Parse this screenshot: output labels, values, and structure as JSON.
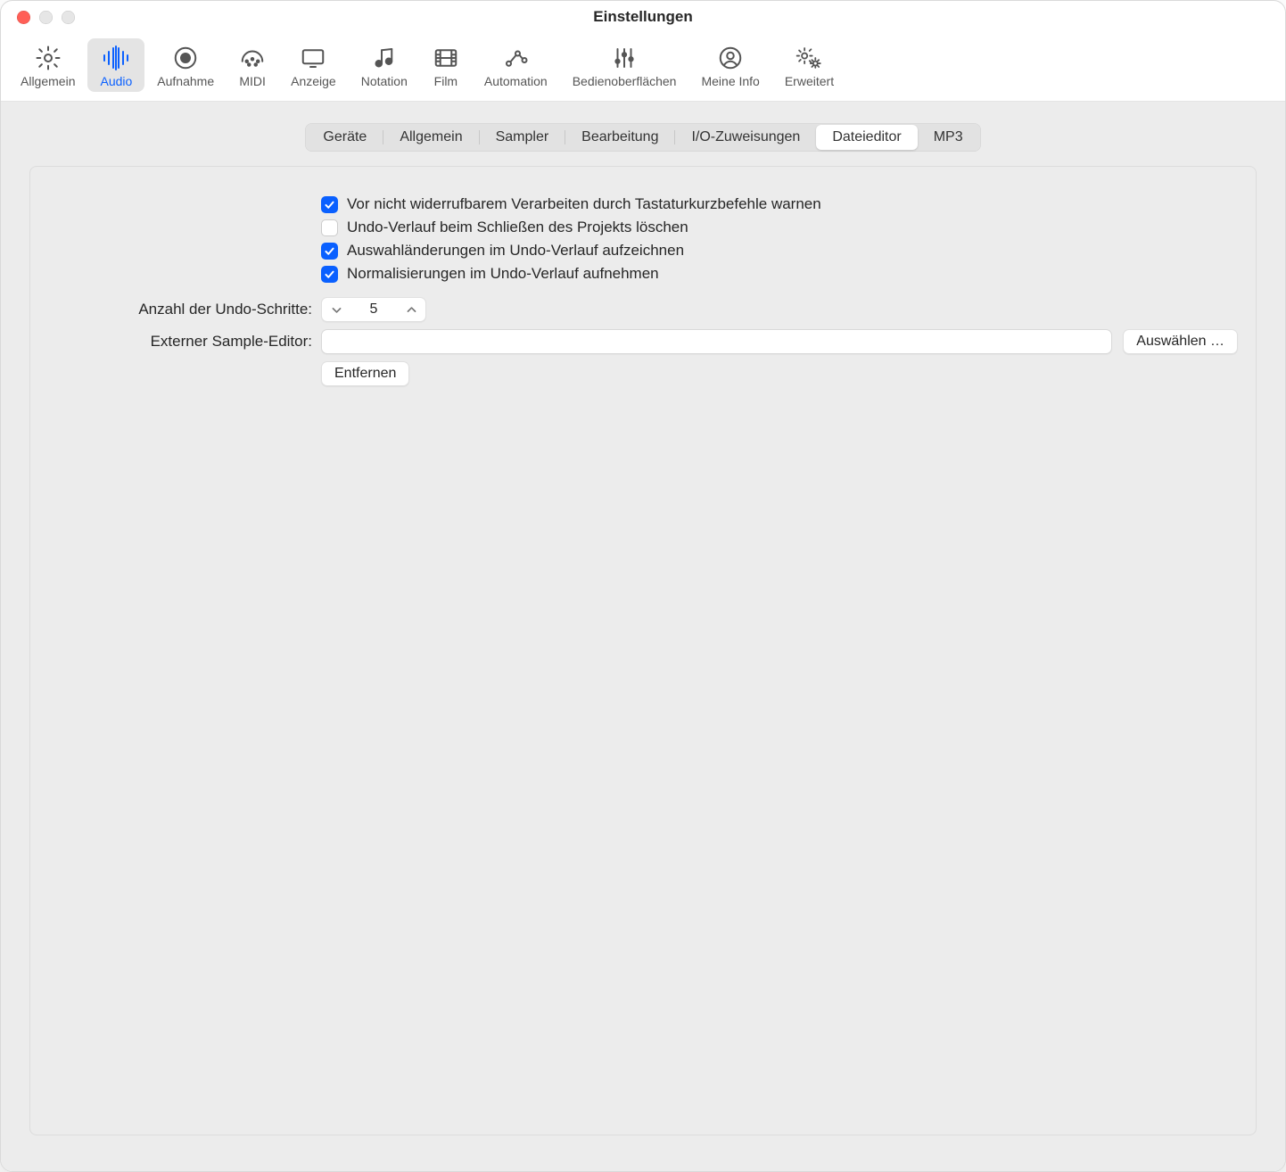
{
  "window": {
    "title": "Einstellungen"
  },
  "toolbar": {
    "items": [
      {
        "label": "Allgemein",
        "icon": "gear-icon"
      },
      {
        "label": "Audio",
        "icon": "audio-wave-icon",
        "active": true
      },
      {
        "label": "Aufnahme",
        "icon": "record-icon"
      },
      {
        "label": "MIDI",
        "icon": "midi-icon"
      },
      {
        "label": "Anzeige",
        "icon": "display-icon"
      },
      {
        "label": "Notation",
        "icon": "notation-icon"
      },
      {
        "label": "Film",
        "icon": "film-icon"
      },
      {
        "label": "Automation",
        "icon": "automation-icon"
      },
      {
        "label": "Bedienoberflächen",
        "icon": "sliders-icon"
      },
      {
        "label": "Meine Info",
        "icon": "account-icon"
      },
      {
        "label": "Erweitert",
        "icon": "advanced-gears-icon"
      }
    ]
  },
  "subtabs": {
    "items": [
      {
        "label": "Geräte"
      },
      {
        "label": "Allgemein"
      },
      {
        "label": "Sampler"
      },
      {
        "label": "Bearbeitung"
      },
      {
        "label": "I/O-Zuweisungen"
      },
      {
        "label": "Dateieditor",
        "active": true
      },
      {
        "label": "MP3"
      }
    ]
  },
  "checks": [
    {
      "label": "Vor nicht widerrufbarem Verarbeiten durch Tastaturkurzbefehle warnen",
      "checked": true
    },
    {
      "label": "Undo-Verlauf beim Schließen des Projekts löschen",
      "checked": false
    },
    {
      "label": "Auswahländerungen im Undo-Verlauf aufzeichnen",
      "checked": true
    },
    {
      "label": "Normalisierungen im Undo-Verlauf aufnehmen",
      "checked": true
    }
  ],
  "undoSteps": {
    "label": "Anzahl der Undo-Schritte:",
    "value": "5"
  },
  "externalEditor": {
    "label": "Externer Sample-Editor:",
    "value": "",
    "chooseLabel": "Auswählen …",
    "removeLabel": "Entfernen"
  }
}
